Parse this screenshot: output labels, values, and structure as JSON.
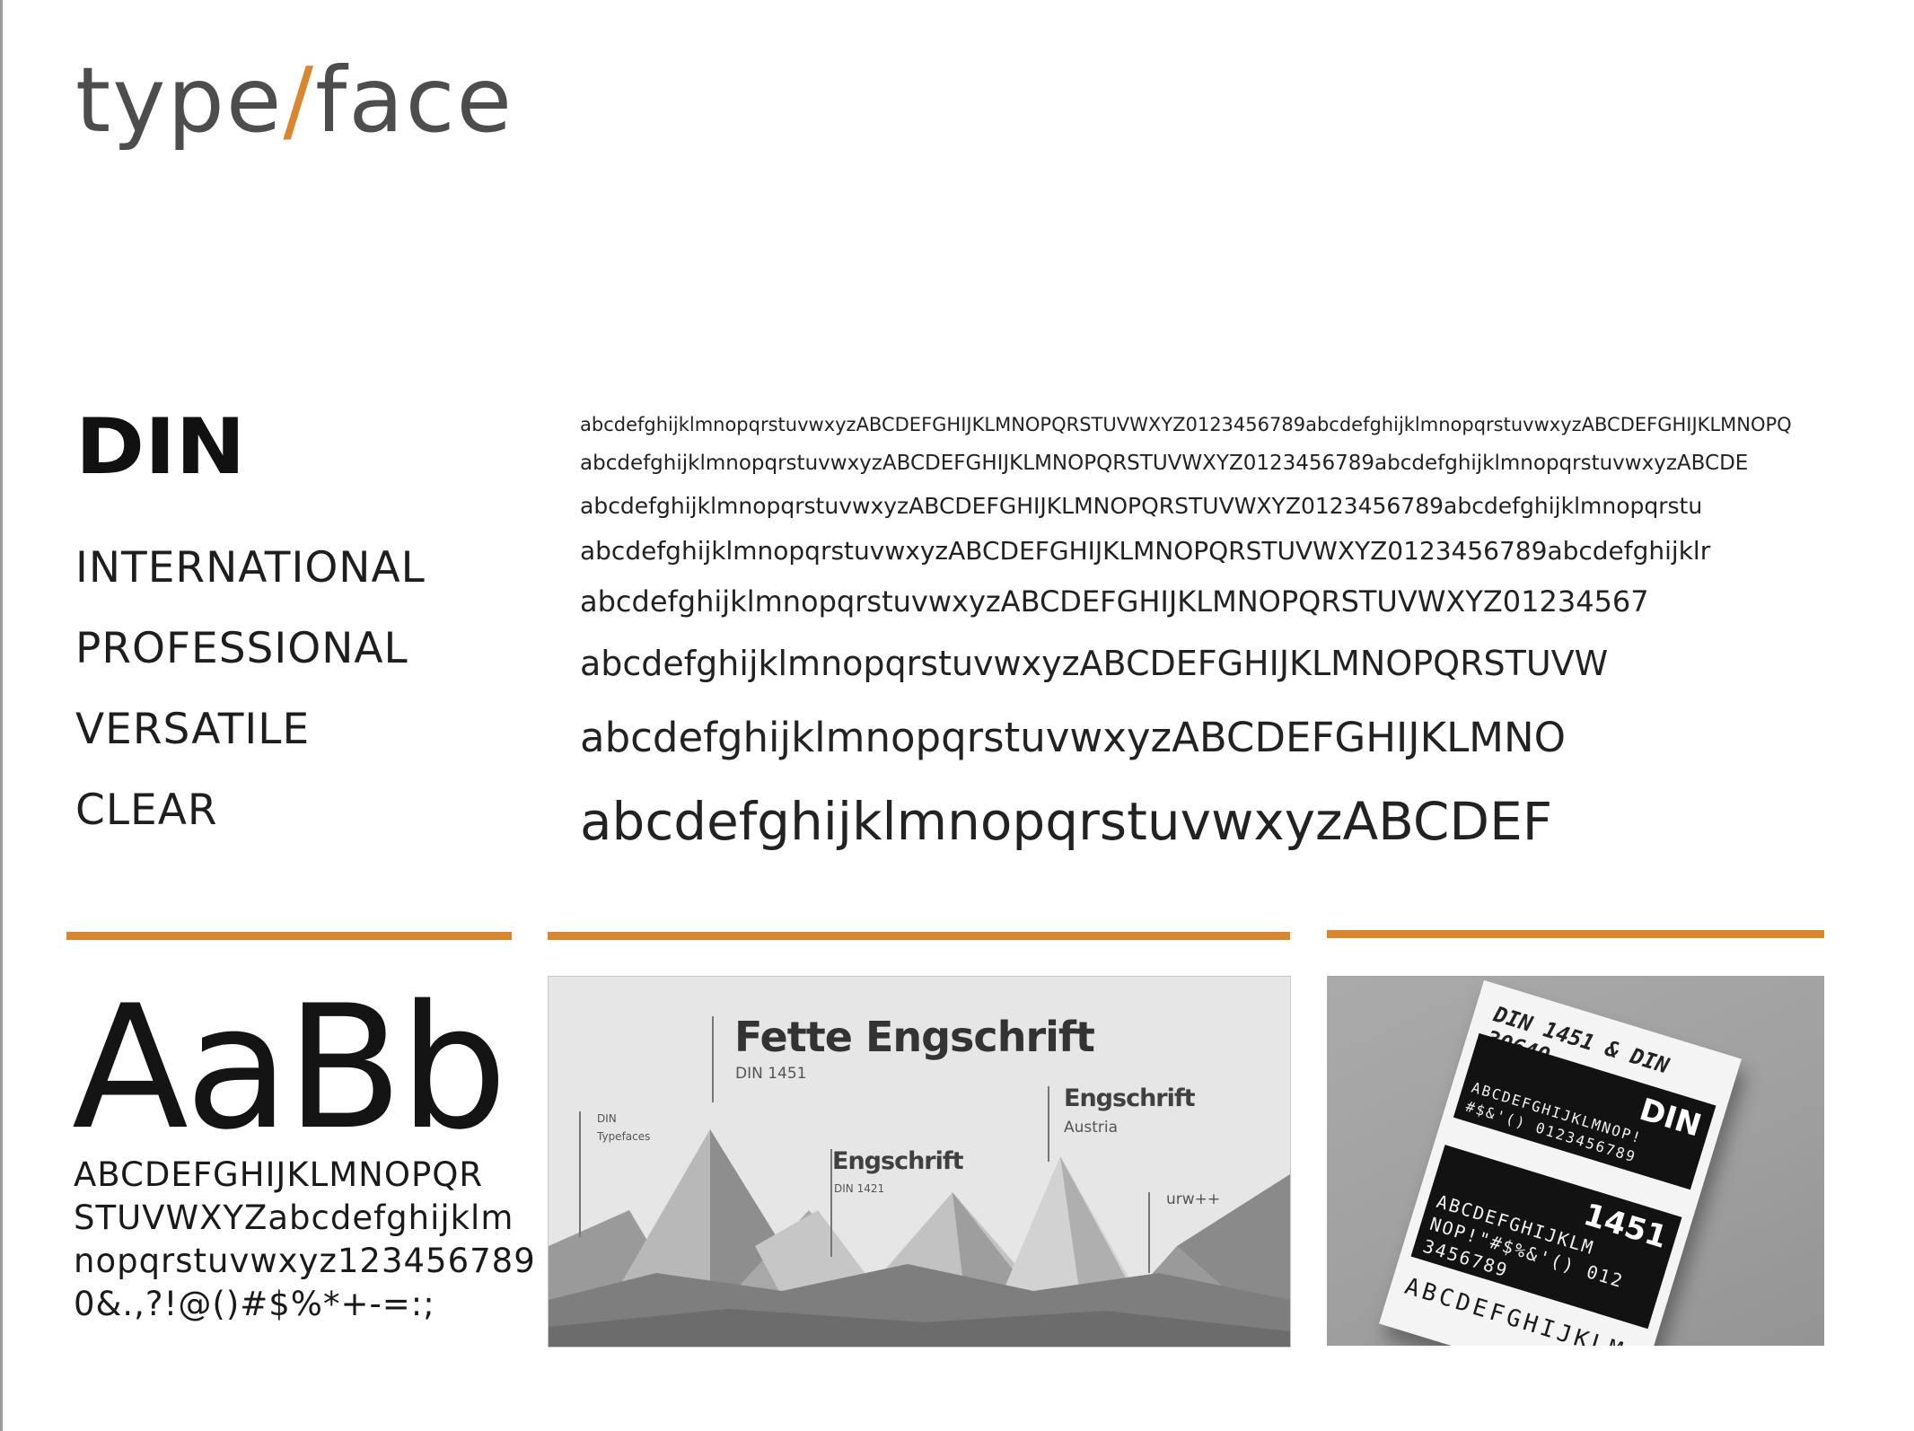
{
  "title": {
    "part1": "type",
    "slash": "/",
    "part2": "face"
  },
  "font_name": "DIN",
  "keywords": [
    "INTERNATIONAL",
    "PROFESSIONAL",
    "VERSATILE",
    "CLEAR"
  ],
  "specimen_lines": [
    "abcdefghijklmnopqrstuvwxyzABCDEFGHIJKLMNOPQRSTUVWXYZ0123456789abcdefghijklmnopqrstuvwxyzABCDEFGHIJKLMNOPQ",
    "abcdefghijklmnopqrstuvwxyzABCDEFGHIJKLMNOPQRSTUVWXYZ0123456789abcdefghijklmnopqrstuvwxyzABCDE",
    "abcdefghijklmnopqrstuvwxyzABCDEFGHIJKLMNOPQRSTUVWXYZ0123456789abcdefghijklmnopqrstu",
    "abcdefghijklmnopqrstuvwxyzABCDEFGHIJKLMNOPQRSTUVWXYZ0123456789abcdefghijklr",
    "abcdefghijklmnopqrstuvwxyzABCDEFGHIJKLMNOPQRSTUVWXYZ01234567",
    "abcdefghijklmnopqrstuvwxyzABCDEFGHIJKLMNOPQRSTUVW",
    "abcdefghijklmnopqrstuvwxyzABCDEFGHIJKLMNO",
    "abcdefghijklmnopqrstuvwxyzABCDEF"
  ],
  "sample_large": "AaBb",
  "charset_lines": [
    "ABCDEFGHIJKLMNOPQR",
    "STUVWXYZabcdefghijklm",
    "nopqrstuvwxyz123456789",
    "0&.,?!@()#$%*+-=:;"
  ],
  "poster": {
    "title": "Fette Engschrift",
    "title_sub": "DIN 1451",
    "side_label_1": "DIN",
    "side_label_2": "Typefaces",
    "label_engschrift": "Engschrift",
    "label_engschrift_sub": "DIN 1421",
    "label_austria": "Engschrift",
    "label_austria_sub": "Austria",
    "label_urw": "urw++"
  },
  "photo": {
    "sheet_header": "DIN 1451 & DIN 30640",
    "block1_tag": "DIN",
    "block1_line1": "ABCDEFGHIJKLMNOP!",
    "block1_line2": "#$&'() 0123456789",
    "block2_tag": "1451",
    "block2_line1": "ABCDEFGHIJKLM",
    "block2_line2": "NOP!\"#$%&'() 012",
    "block2_line3": "3456789",
    "sheet_footer": "ABCDEFGHIJKLM"
  },
  "colors": {
    "accent": "#d9862e",
    "text": "#1a1a1a",
    "title_gray": "#4d4d4d"
  }
}
